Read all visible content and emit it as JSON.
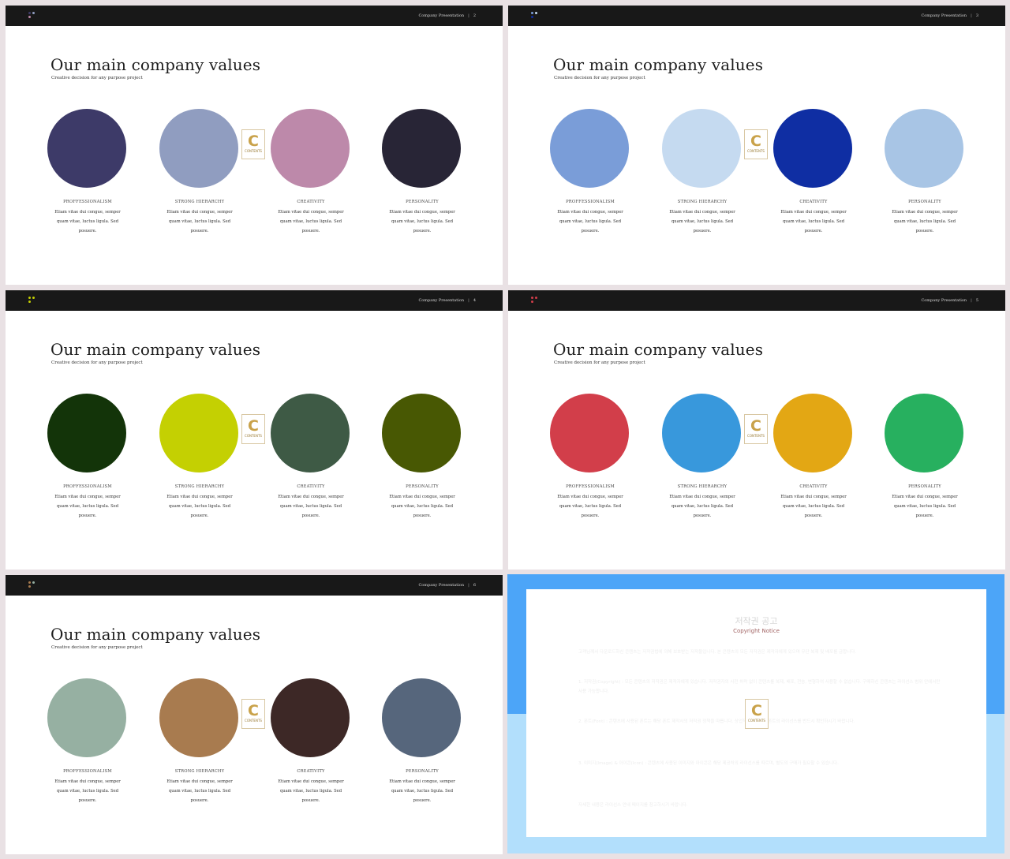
{
  "header_text": "Company Presentation",
  "slide_title": "Our main company values",
  "slide_subtitle": "Creative decision for any purpose  project",
  "watermark": {
    "letter": "C",
    "text": "CONTENTS"
  },
  "values": [
    {
      "label": "PROFFESSIONALISM",
      "body": "Etiam vitae dui congue, semper quam vitae, luctus ligula. Sed posuere."
    },
    {
      "label": "STRONG HIERARCHY",
      "body": "Etiam vitae dui congue, semper quam vitae, luctus ligula. Sed posuere."
    },
    {
      "label": "CREATIVITY",
      "body": "Etiam vitae dui congue, semper quam vitae, luctus ligula. Sed posuere."
    },
    {
      "label": "PERSONALITY",
      "body": "Etiam vitae dui congue, semper quam vitae, luctus ligula. Sed posuere."
    }
  ],
  "slides": [
    {
      "page": "2",
      "colors": [
        "#3d3a68",
        "#909dc0",
        "#bd89aa",
        "#282536"
      ],
      "dot_colors": [
        "#3d3a68",
        "#909dc0",
        "#bd89aa"
      ]
    },
    {
      "page": "3",
      "colors": [
        "#7a9dd8",
        "#c5daf0",
        "#0f2ea3",
        "#a8c5e5"
      ],
      "dot_colors": [
        "#7a9dd8",
        "#c5daf0",
        "#0f2ea3"
      ]
    },
    {
      "page": "4",
      "colors": [
        "#133409",
        "#c4d002",
        "#3e5a45",
        "#485803"
      ],
      "dot_colors": [
        "#c4d002",
        "#c4d002",
        "#c4d002"
      ]
    },
    {
      "page": "5",
      "colors": [
        "#d23e4a",
        "#3898dc",
        "#e3a714",
        "#27b05f"
      ],
      "dot_colors": [
        "#d23e4a",
        "#d23e4a",
        "#d23e4a"
      ]
    },
    {
      "page": "6",
      "colors": [
        "#96b0a2",
        "#a87b4f",
        "#3d2826",
        "#56667c"
      ],
      "dot_colors": [
        "#a87b4f",
        "#96b0a2",
        "#a87b4f"
      ]
    }
  ],
  "notice": {
    "title": "저작권 공고",
    "subtitle": "Copyright Notice",
    "paragraphs": [
      "고객님께서 다운로드하신 콘텐츠는 저작권법에 의해 보호받는 저작물입니다. 본 콘텐츠의 모든 저작권은 제작자에게 있으며 무단 복제 및 배포를 금합니다.",
      "1. 저작권(Copyright) : 모든 콘텐츠의 저작권은 제작자에게 있습니다. 저작권자의 사전 허락 없이 콘텐츠를 복제, 배포, 전송, 변형하여 사용할 수 없습니다. 구매하신 콘텐츠는 라이선스 범위 안에서만 사용 가능합니다.",
      "2. 폰트(Font) : 콘텐츠에 사용된 폰트는 해당 폰트 제작사의 저작권 정책을 따릅니다. 상업적 이용 시 각 폰트의 라이선스를 반드시 확인하시기 바랍니다.",
      "3. 이미지(Image) & 아이콘(Icon) : 콘텐츠에 사용된 이미지와 아이콘은 해당 제공처의 라이선스를 따르며, 별도의 구매가 필요할 수 있습니다.",
      "자세한 내용은 라이선스 안내 페이지를 참고하시기 바랍니다."
    ]
  }
}
